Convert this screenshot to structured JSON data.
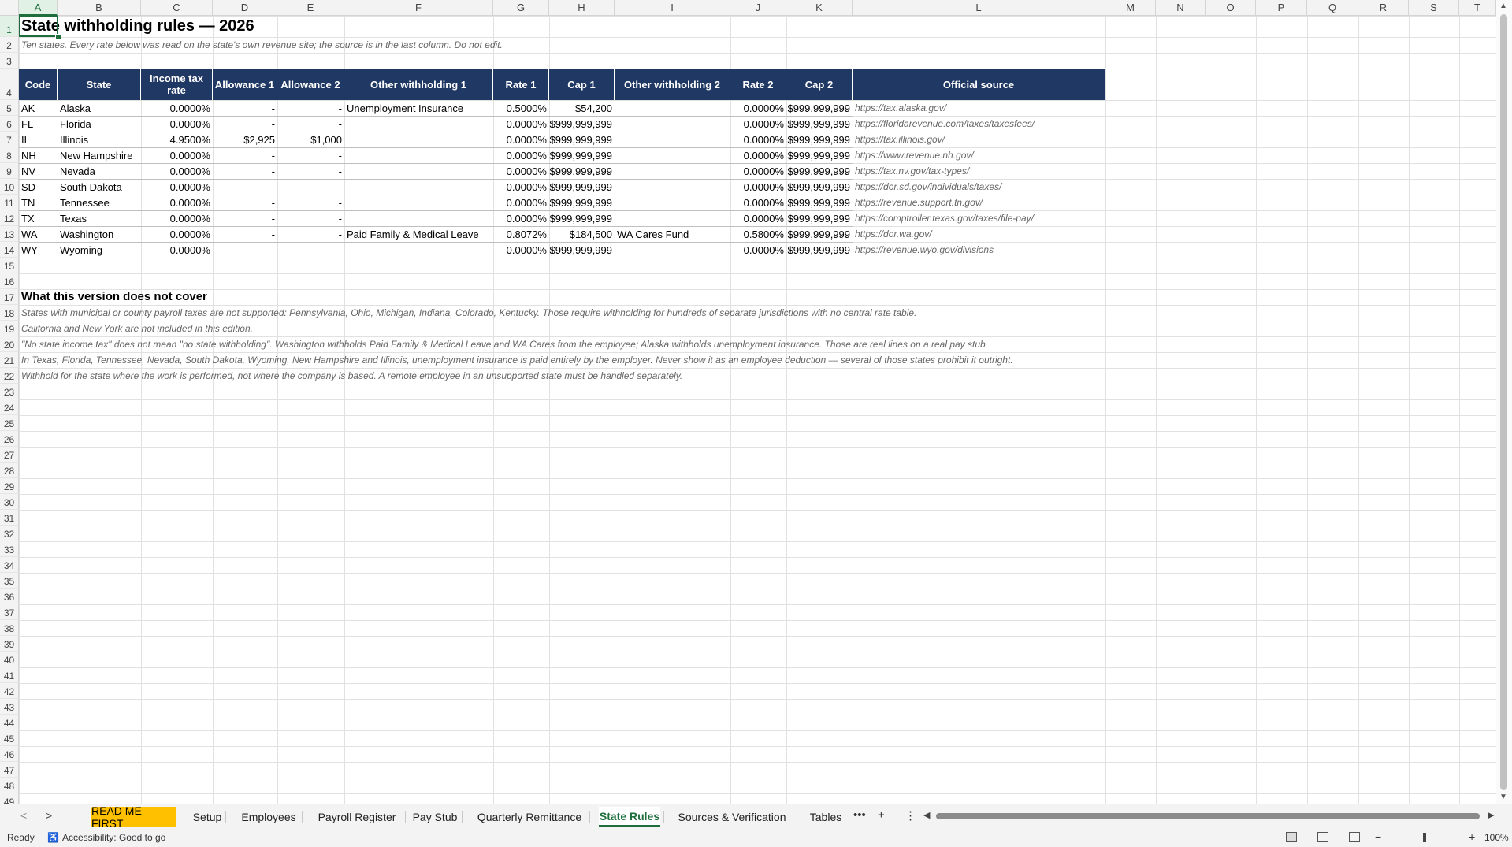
{
  "columns": [
    "A",
    "B",
    "C",
    "D",
    "E",
    "F",
    "G",
    "H",
    "I",
    "J",
    "K",
    "L",
    "M",
    "N",
    "O",
    "P",
    "Q",
    "R",
    "S",
    "T"
  ],
  "rows": [
    "1",
    "2",
    "3",
    "4",
    "5",
    "6",
    "7",
    "8",
    "9",
    "10",
    "11",
    "12",
    "13",
    "14",
    "15",
    "16",
    "17",
    "18",
    "19",
    "20",
    "21",
    "22",
    "23",
    "24",
    "25",
    "26",
    "27",
    "28",
    "29",
    "30",
    "31",
    "32",
    "33",
    "34",
    "35",
    "36",
    "37",
    "38",
    "39",
    "40",
    "41",
    "42",
    "43",
    "44",
    "45",
    "46",
    "47",
    "48",
    "49"
  ],
  "sheet": {
    "title_selected_part": "State",
    "title_rest": " withholding rules — 2026",
    "subtitle": "Ten states. Every rate below was read on the state's own revenue site; the source is in the last column. Do not edit.",
    "table_headers": [
      "Code",
      "State",
      "Income tax rate",
      "Allowance 1",
      "Allowance 2",
      "Other withholding 1",
      "Rate 1",
      "Cap 1",
      "Other withholding 2",
      "Rate 2",
      "Cap 2",
      "Official source"
    ],
    "table_rows": [
      [
        "AK",
        "Alaska",
        "0.0000%",
        "-",
        "-",
        "Unemployment Insurance",
        "0.5000%",
        "$54,200",
        "",
        "0.0000%",
        "$999,999,999",
        "https://tax.alaska.gov/"
      ],
      [
        "FL",
        "Florida",
        "0.0000%",
        "-",
        "-",
        "",
        "0.0000%",
        "$999,999,999",
        "",
        "0.0000%",
        "$999,999,999",
        "https://floridarevenue.com/taxes/taxesfees/"
      ],
      [
        "IL",
        "Illinois",
        "4.9500%",
        "$2,925",
        "$1,000",
        "",
        "0.0000%",
        "$999,999,999",
        "",
        "0.0000%",
        "$999,999,999",
        "https://tax.illinois.gov/"
      ],
      [
        "NH",
        "New Hampshire",
        "0.0000%",
        "-",
        "-",
        "",
        "0.0000%",
        "$999,999,999",
        "",
        "0.0000%",
        "$999,999,999",
        "https://www.revenue.nh.gov/"
      ],
      [
        "NV",
        "Nevada",
        "0.0000%",
        "-",
        "-",
        "",
        "0.0000%",
        "$999,999,999",
        "",
        "0.0000%",
        "$999,999,999",
        "https://tax.nv.gov/tax-types/"
      ],
      [
        "SD",
        "South Dakota",
        "0.0000%",
        "-",
        "-",
        "",
        "0.0000%",
        "$999,999,999",
        "",
        "0.0000%",
        "$999,999,999",
        "https://dor.sd.gov/individuals/taxes/"
      ],
      [
        "TN",
        "Tennessee",
        "0.0000%",
        "-",
        "-",
        "",
        "0.0000%",
        "$999,999,999",
        "",
        "0.0000%",
        "$999,999,999",
        "https://revenue.support.tn.gov/"
      ],
      [
        "TX",
        "Texas",
        "0.0000%",
        "-",
        "-",
        "",
        "0.0000%",
        "$999,999,999",
        "",
        "0.0000%",
        "$999,999,999",
        "https://comptroller.texas.gov/taxes/file-pay/"
      ],
      [
        "WA",
        "Washington",
        "0.0000%",
        "-",
        "-",
        "Paid Family & Medical Leave",
        "0.8072%",
        "$184,500",
        "WA Cares Fund",
        "0.5800%",
        "$999,999,999",
        "https://dor.wa.gov/"
      ],
      [
        "WY",
        "Wyoming",
        "0.0000%",
        "-",
        "-",
        "",
        "0.0000%",
        "$999,999,999",
        "",
        "0.0000%",
        "$999,999,999",
        "https://revenue.wyo.gov/divisions"
      ]
    ],
    "section_title": "What this version does not cover",
    "notes": [
      "States with municipal or county payroll taxes are not supported: Pennsylvania, Ohio, Michigan, Indiana, Colorado, Kentucky. Those require withholding for hundreds of separate jurisdictions with no central rate table.",
      "California and New York are not included in this edition.",
      "\"No state income tax\" does not mean \"no state withholding\". Washington withholds Paid Family & Medical Leave and WA Cares from the employee; Alaska withholds unemployment insurance. Those are real lines on a real pay stub.",
      "In Texas, Florida, Tennessee, Nevada, South Dakota, Wyoming, New Hampshire and Illinois, unemployment insurance is paid entirely by the employer. Never show it as an employee deduction — several of those states prohibit it outright.",
      "Withhold for the state where the work is performed, not where the company is based. A remote employee in an unsupported state must be handled separately."
    ]
  },
  "tabs": {
    "prev_icon": "chevron-left-icon",
    "next_icon": "chevron-right-icon",
    "items": [
      "READ ME FIRST",
      "Setup",
      "Employees",
      "Payroll Register",
      "Pay Stub",
      "Quarterly Remittance",
      "State Rules",
      "Sources & Verification",
      "Tables"
    ],
    "active": "State Rules",
    "highlight": "READ ME FIRST",
    "more_label": "•••",
    "add_label": "+",
    "options_label": "⋮"
  },
  "status": {
    "ready": "Ready",
    "accessibility": "Accessibility: Good to go",
    "zoom_minus": "−",
    "zoom_plus": "+",
    "zoom": "100%"
  },
  "colors": {
    "header_fill": "#1f3864",
    "accent_green": "#1e6e3c",
    "tab_highlight": "#ffc000"
  }
}
